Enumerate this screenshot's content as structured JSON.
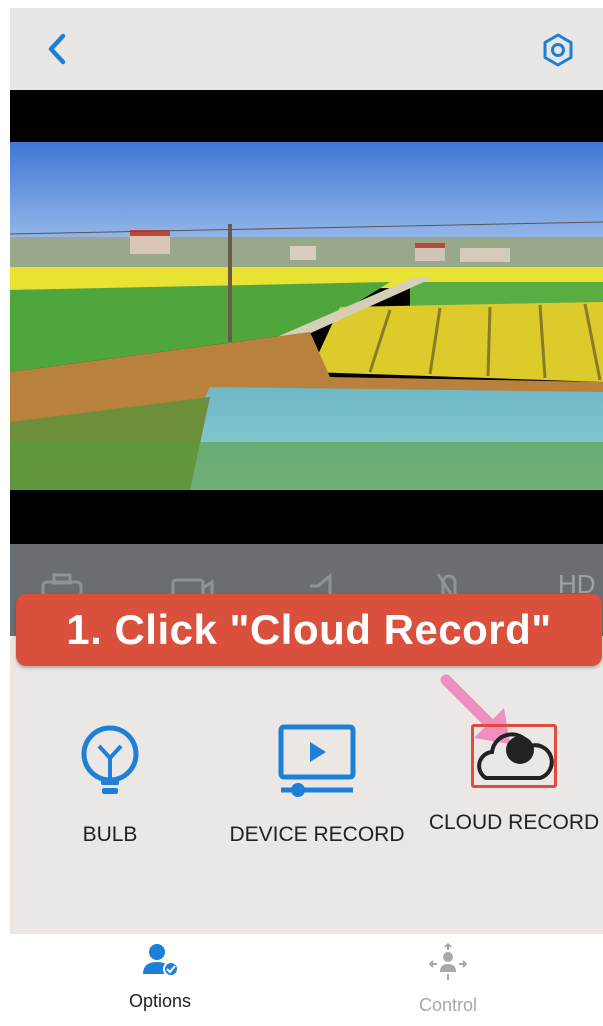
{
  "header": {
    "back_icon": "chevron-left-icon",
    "settings_icon": "gear-icon"
  },
  "video": {
    "quality_label": "HD"
  },
  "banner": {
    "text": "1. Click \"Cloud Record\""
  },
  "options": [
    {
      "label": "BULB",
      "icon": "bulb-icon"
    },
    {
      "label": "DEVICE RECORD",
      "icon": "video-play-icon"
    },
    {
      "label": "CLOUD RECORD",
      "icon": "cloud-icon"
    }
  ],
  "tabs": [
    {
      "label": "Options",
      "icon": "person-check-icon",
      "active": true
    },
    {
      "label": "Control",
      "icon": "ptz-control-icon",
      "active": false
    }
  ],
  "colors": {
    "accent": "#1d7fd6",
    "highlight": "#e04b3b",
    "banner": "#d9503c",
    "inactive": "#a8a8a8"
  }
}
